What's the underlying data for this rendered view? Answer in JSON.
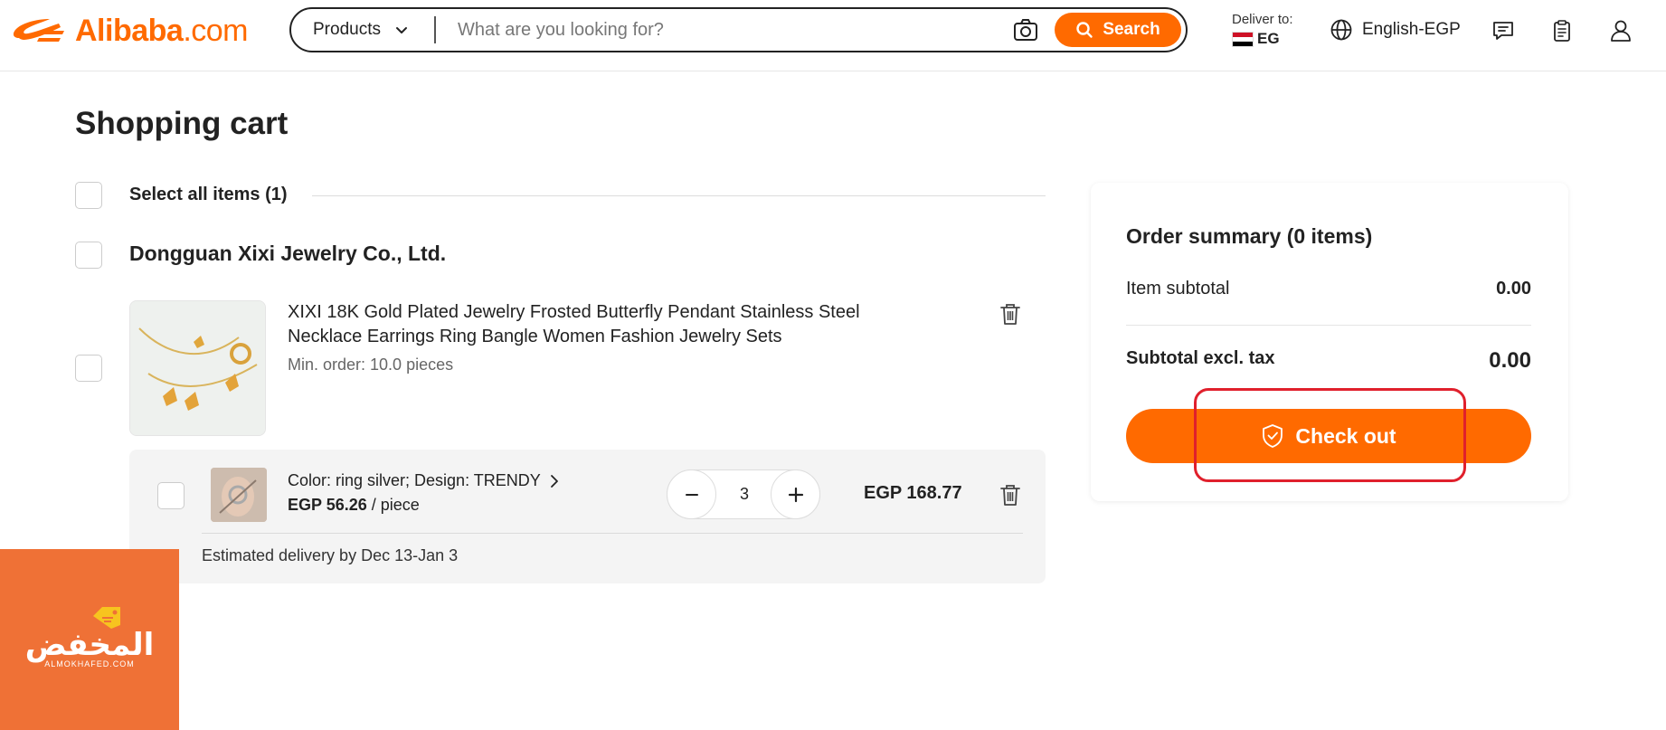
{
  "header": {
    "logo_brand": "Alibaba",
    "logo_suffix": ".com",
    "search": {
      "category": "Products",
      "placeholder": "What are you looking for?",
      "button_label": "Search"
    },
    "deliver": {
      "label": "Deliver to:",
      "country": "EG"
    },
    "language": "English-EGP"
  },
  "cart": {
    "title": "Shopping cart",
    "select_all_label": "Select all items (1)",
    "supplier": "Dongguan Xixi Jewelry Co., Ltd.",
    "product": {
      "name": "XIXI 18K Gold Plated Jewelry Frosted Butterfly Pendant Stainless Steel Necklace Earrings Ring Bangle Women Fashion Jewelry Sets",
      "min_order": "Min. order: 10.0 pieces",
      "variant": {
        "attributes": "Color: ring silver; Design: TRENDY",
        "unit_price": "EGP 56.26",
        "unit_suffix": " / piece",
        "quantity": "3",
        "line_total": "EGP 168.77",
        "estimated_delivery": "Estimated delivery by Dec 13-Jan 3"
      }
    }
  },
  "summary": {
    "title": "Order summary (0 items)",
    "item_subtotal_label": "Item subtotal",
    "item_subtotal_value": "0.00",
    "subtotal_excl_tax_label": "Subtotal excl. tax",
    "subtotal_excl_tax_value": "0.00",
    "checkout_label": "Check out"
  },
  "watermark": {
    "text": "المخفض",
    "subtext": "ALMOKHAFED.COM"
  },
  "colors": {
    "brand_orange": "#ff6a00",
    "highlight_red": "#e0202c",
    "watermark_bg": "#ef7136"
  }
}
